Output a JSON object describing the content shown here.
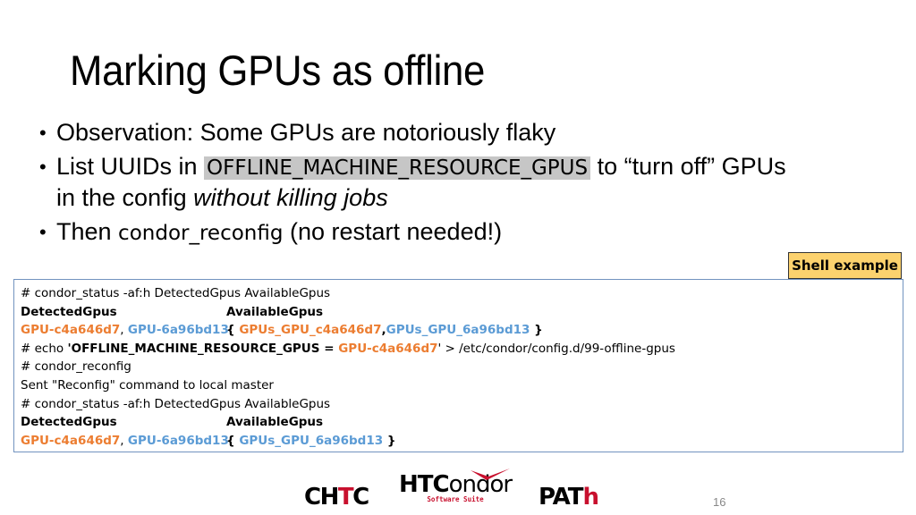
{
  "slide": {
    "title": "Marking GPUs as offline",
    "bullets": [
      {
        "text": "Observation: Some GPUs are notoriously flaky"
      },
      {
        "pre": "List UUIDs in ",
        "code": "OFFLINE_MACHINE_RESOURCE_GPUS",
        "post": " to “turn off” GPUs",
        "line2_pre": "in the config ",
        "line2_italic": "without killing jobs"
      },
      {
        "pre": "Then ",
        "code": "condor_reconfig",
        "post": " (no restart needed!)"
      }
    ],
    "tag_label": "Shell example",
    "page_number": "16"
  },
  "shell": {
    "cmd1": "# condor_status -af:h DetectedGpus AvailableGpus",
    "header_detected": "DetectedGpus",
    "header_available": "AvailableGpus",
    "gpu_a": "GPU-c4a646d7",
    "gpu_b": "GPU-6a96bd13",
    "sep": ", ",
    "avail_open": "{ ",
    "avail_a": "GPUs_GPU_c4a646d7",
    "avail_comma": ",",
    "avail_b": "GPUs_GPU_6a96bd13",
    "avail_close": " }",
    "echo_pre": "# echo ",
    "echo_key": "'OFFLINE_MACHINE_RESOURCE_GPUS = ",
    "echo_val": "GPU-c4a646d7",
    "echo_post": "' > /etc/condor/config.d/99-offline-gpus",
    "cmd2": "# condor_reconfig",
    "reply": "Sent \"Reconfig\" command to local master",
    "cmd3": "# condor_status -af:h DetectedGpus AvailableGpus"
  },
  "logos": {
    "chtc_a": "CH",
    "chtc_b": "T",
    "chtc_c": "C",
    "htc_bold": "HTC",
    "htc_rest": "ondor",
    "htc_sub": "Software Suite",
    "path_a": "PAT",
    "path_b": "h"
  },
  "colors": {
    "highlight_orange": "#ec7d31",
    "highlight_blue": "#5b9bd5",
    "tag_yellow": "#fcd26e",
    "border_blue": "#7293bf"
  }
}
